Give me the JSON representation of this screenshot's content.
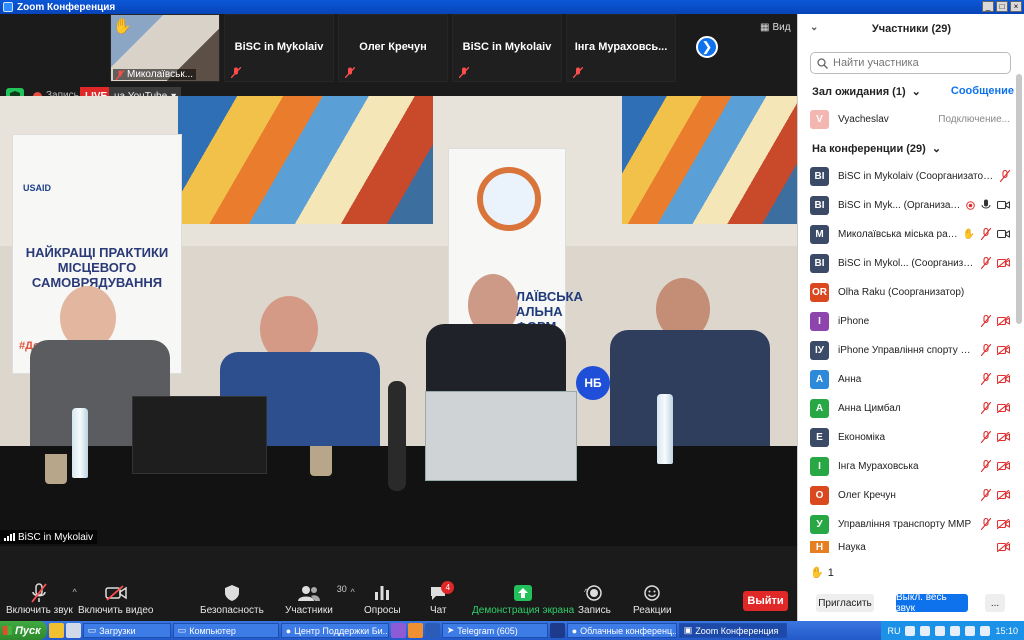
{
  "window": {
    "title": "Zoom Конференция",
    "min": "_",
    "max": "□",
    "close": "×"
  },
  "strip": {
    "thumbs": [
      {
        "name": "",
        "label": "Миколаївськ..."
      },
      {
        "name": "BiSC in Mykolaiv"
      },
      {
        "name": "Олег Кречун"
      },
      {
        "name": "BiSC in Mykolaiv"
      },
      {
        "name": "Інга Мураховсь..."
      }
    ],
    "view_label": "Вид"
  },
  "status": {
    "record_label": "Запись",
    "live_label": "LIVE",
    "stream_label": "на YouTube"
  },
  "scene": {
    "banner_left": "НАЙКРАЩІ ПРАКТИКИ МІСЦЕВОГО САМОВРЯДУВАННЯ",
    "banner_left_tag": "#Дорож...",
    "usaid": "USAID",
    "banner_right": "...ЛАЇВСЬКА ...АЛЬНА ...ФОРМ",
    "mic_logo": "НБ"
  },
  "speaker": {
    "name": "BiSC in Mykolaiv"
  },
  "toolbar": {
    "mute": "Включить звук",
    "video": "Включить видео",
    "security": "Безопасность",
    "participants": "Участники",
    "participants_count": "30",
    "polls": "Опросы",
    "chat": "Чат",
    "chat_badge": "4",
    "share": "Демонстрация экрана",
    "record": "Запись",
    "reactions": "Реакции",
    "leave": "Выйти"
  },
  "panel": {
    "title": "Участники (29)",
    "search_placeholder": "Найти участника",
    "waiting_label": "Зал ожидания (1)",
    "message_link": "Сообщение",
    "waiting": {
      "initial": "V",
      "name": "Vyacheslav",
      "status": "Подключение..."
    },
    "in_meeting_label": "На конференции (29)",
    "participants": [
      {
        "initial": "BI",
        "name": "BiSC in Mykolaiv (Соорганизатор, я)",
        "color": "#3b4a66"
      },
      {
        "initial": "BI",
        "name": "BiSC in Myk... (Организатор)",
        "color": "#3b4a66"
      },
      {
        "initial": "M",
        "name": "Миколаївська міська рада",
        "color": "#3b4a66"
      },
      {
        "initial": "BI",
        "name": "BiSC in Mykol... (Соорганизатор)",
        "color": "#3b4a66"
      },
      {
        "initial": "OR",
        "name": "Olha Raku (Соорганизатор)",
        "color": "#d9481e"
      },
      {
        "initial": "I",
        "name": "iPhone",
        "color": "#8e44ad"
      },
      {
        "initial": "IУ",
        "name": "iPhone Управління спорту ММР",
        "color": "#3b4a66"
      },
      {
        "initial": "A",
        "name": "Анна",
        "color": "#2f89d9"
      },
      {
        "initial": "A",
        "name": "Анна Цимбал",
        "color": "#27a844"
      },
      {
        "initial": "E",
        "name": "Економіка",
        "color": "#3b4a66"
      },
      {
        "initial": "I",
        "name": "Інга Мураховська",
        "color": "#27a844"
      },
      {
        "initial": "O",
        "name": "Олег Кречун",
        "color": "#d9481e"
      },
      {
        "initial": "У",
        "name": "Управління транспорту ММР",
        "color": "#27a844"
      },
      {
        "initial": "Н",
        "name": "Наука",
        "color": "#e67e22"
      }
    ],
    "raised_count": "1",
    "invite": "Пригласить",
    "mute_all": "Выкл. весь звук",
    "more": "..."
  },
  "taskbar": {
    "start": "Пуск",
    "items": [
      "Загрузки",
      "Компьютер",
      "Центр Поддержки Би...",
      "Telegram (605)",
      "Облачные конференц...",
      "Zoom Конференция"
    ],
    "lang": "RU",
    "clock": "15:10"
  }
}
